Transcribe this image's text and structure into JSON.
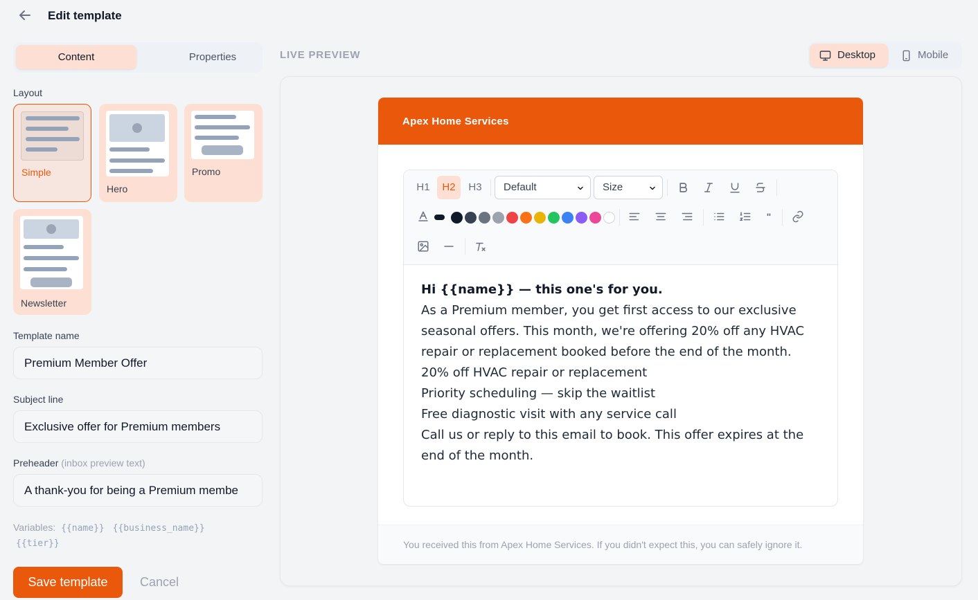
{
  "header": {
    "title": "Edit template"
  },
  "tabs": [
    {
      "label": "Content",
      "active": true
    },
    {
      "label": "Properties",
      "active": false
    }
  ],
  "layout": {
    "label": "Layout",
    "options": [
      {
        "label": "Simple",
        "selected": true
      },
      {
        "label": "Hero",
        "selected": false
      },
      {
        "label": "Promo",
        "selected": false
      },
      {
        "label": "Newsletter",
        "selected": false
      }
    ]
  },
  "fields": {
    "template_name": {
      "label": "Template name",
      "value": "Premium Member Offer"
    },
    "subject": {
      "label": "Subject line",
      "value": "Exclusive offer for Premium members"
    },
    "preheader": {
      "label": "Preheader",
      "hint": "(inbox preview text)",
      "value": "A thank-you for being a Premium membe"
    }
  },
  "variables": {
    "label": "Variables:",
    "items": [
      "{{name}}",
      "{{business_name}}",
      "{{tier}}"
    ]
  },
  "actions": {
    "save": "Save template",
    "cancel": "Cancel"
  },
  "preview": {
    "label": "LIVE PREVIEW",
    "devices": [
      {
        "label": "Desktop",
        "active": true
      },
      {
        "label": "Mobile",
        "active": false
      }
    ]
  },
  "email": {
    "brand": "Apex Home Services",
    "footer": "You received this from Apex Home Services. If you didn't expect this, you can safely ignore it.",
    "body": {
      "greeting": "Hi {{name}} — this one's for you.",
      "lines": [
        "As a Premium member, you get first access to our exclusive seasonal offers. This month, we're offering 20% off any HVAC repair or replacement booked before the end of the month.",
        "20% off HVAC repair or replacement",
        "Priority scheduling — skip the waitlist",
        "Free diagnostic visit with any service call",
        "Call us or reply to this email to book. This offer expires at the end of the month."
      ]
    }
  },
  "editor": {
    "headings": [
      "H1",
      "H2",
      "H3"
    ],
    "active_heading": "H2",
    "font_select": "Default",
    "size_select": "Size",
    "swatch_colors": [
      "#1f2937",
      "#374151",
      "#6b7280",
      "#9ca3af",
      "#ef4444",
      "#f97316",
      "#eab308",
      "#22c55e",
      "#3b82f6",
      "#8b5cf6",
      "#ec4899",
      "#ffffff"
    ],
    "accent": "#ea580c"
  }
}
